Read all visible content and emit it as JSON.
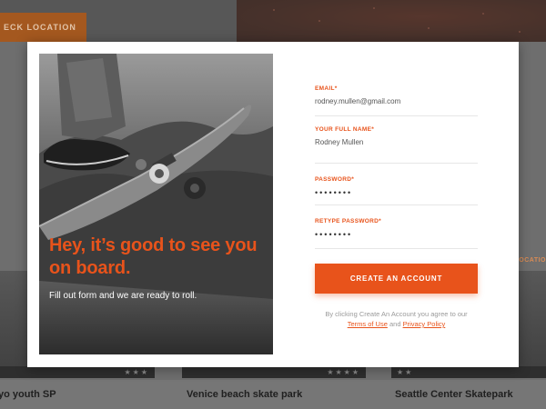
{
  "background": {
    "location_button": "ECK LOCATION",
    "side_label": "LOCATIO",
    "cards": [
      {
        "title": "yo youth SP"
      },
      {
        "title": "Venice beach skate park"
      },
      {
        "title": "Seattle Center Skatepark"
      }
    ]
  },
  "hero": {
    "heading": "Hey, it’s good to see you on board.",
    "subheading": "Fill out form and we are ready to roll."
  },
  "form": {
    "email_label": "EMAIL*",
    "email_value": "rodney.mullen@gmail.com",
    "name_label": "YOUR FULL NAME*",
    "name_value": "Rodney Mullen",
    "password_label": "PASSWORD*",
    "password_value": "••••••••",
    "retype_label": "RETYPE PASSWORD*",
    "retype_value": "••••••••",
    "submit_label": "CREATE AN ACCOUNT",
    "terms_prefix": "By clicking Create An Account you agree to our",
    "terms_link": "Terms of Use",
    "terms_and": "and",
    "privacy_link": "Privacy Policy"
  },
  "colors": {
    "accent": "#e8531b",
    "overlay": "#6e6e6e"
  }
}
